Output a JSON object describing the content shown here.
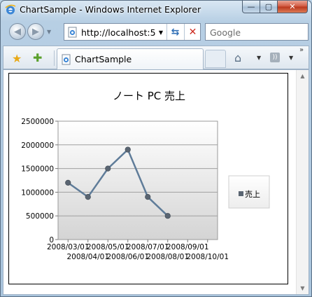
{
  "window": {
    "title": "ChartSample - Windows Internet Explorer",
    "minimize": "—",
    "maximize": "▢",
    "close": "✕"
  },
  "nav": {
    "back": "◀",
    "forward": "▶",
    "history_dropdown": "▼",
    "address": "http://localhost:5",
    "address_dropdown": "▼",
    "refresh": "⇆",
    "stop": "✕",
    "search_placeholder": "Google"
  },
  "tabs": {
    "active_label": "ChartSample",
    "home_dropdown": "▼",
    "feed": "))",
    "feed_dropdown": "▼",
    "more": "»"
  },
  "chart_data": {
    "type": "line",
    "title": "ノート PC 売上",
    "categories": [
      "2008/03/01",
      "2008/04/01",
      "2008/05/01",
      "2008/06/01",
      "2008/07/01",
      "2008/08/01",
      "2008/09/01",
      "2008/10/01"
    ],
    "series": [
      {
        "name": "売上",
        "values": [
          1200000,
          900000,
          1500000,
          1900000,
          900000,
          500000
        ]
      }
    ],
    "ylim": [
      0,
      2500000
    ],
    "yticks": [
      0,
      500000,
      1000000,
      1500000,
      2000000,
      2500000
    ],
    "grid": true,
    "legend": "right",
    "colors": {
      "line": "#5f7c99",
      "marker": "#5a6572",
      "plot_top": "#ffffff",
      "plot_bottom": "#d4d4d4"
    }
  }
}
